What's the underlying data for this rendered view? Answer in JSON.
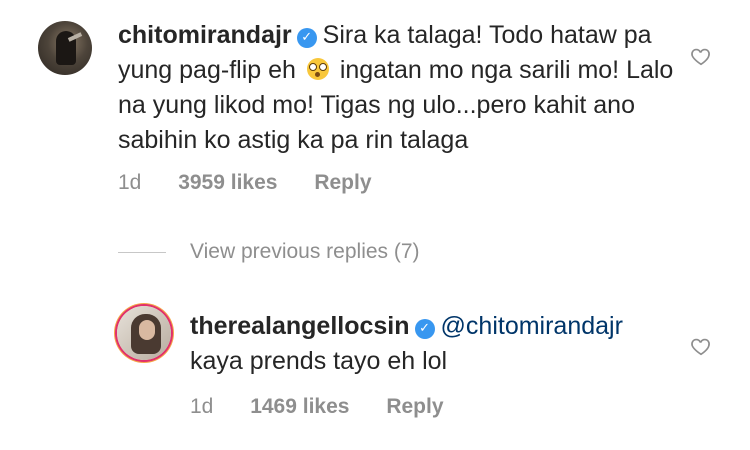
{
  "comments": [
    {
      "username": "chitomirandajr",
      "verified": true,
      "text_part1": "Sira ka talaga! Todo hataw pa yung pag-flip eh",
      "emoji": "flushed-face-emoji",
      "text_part2": "ingatan mo nga sarili mo! Lalo na yung likod mo! Tigas ng ulo...pero kahit ano sabihin ko astig ka pa rin talaga",
      "time": "1d",
      "likes": "3959 likes",
      "reply_label": "Reply",
      "like_icon": "heart-outline-icon"
    },
    {
      "username": "therealangellocsin",
      "verified": true,
      "mention": "@chitomirandajr",
      "text": "kaya prends tayo eh lol",
      "time": "1d",
      "likes": "1469 likes",
      "reply_label": "Reply",
      "like_icon": "heart-outline-icon"
    }
  ],
  "view_previous_replies": "View previous replies (7)",
  "colors": {
    "text": "#262626",
    "secondary": "#8e8e8e",
    "verified": "#3897f0",
    "mention": "#003569"
  }
}
